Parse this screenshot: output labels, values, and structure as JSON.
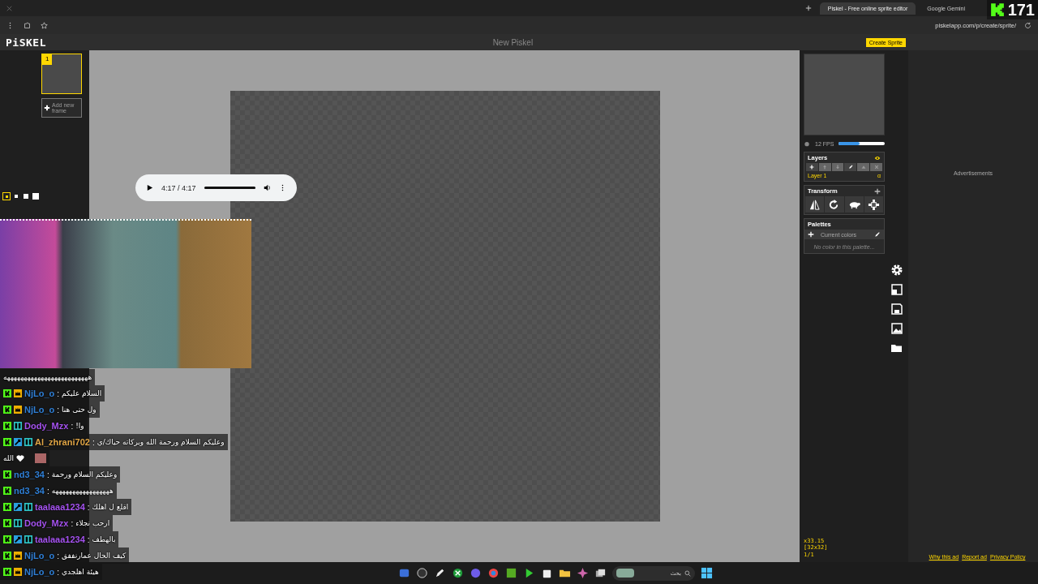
{
  "browser": {
    "tabs": [
      {
        "title": "Piskel - Free online sprite editor",
        "selected": true
      },
      {
        "title": "Google Gemini",
        "selected": false
      }
    ],
    "url": "piskelapp.com/p/create/sprite/"
  },
  "stream_overlay": {
    "viewer_count": "171"
  },
  "piskel": {
    "logo": "PiSKEL",
    "title": "New Piskel",
    "create_button": "Create Sprite",
    "frames": [
      {
        "number": "1",
        "selected": true
      }
    ],
    "add_frame": "Add new frame",
    "pen_sizes": [
      {
        "selected": true
      },
      {
        "selected": false
      },
      {
        "selected": false
      },
      {
        "selected": false
      }
    ],
    "preview": {
      "fps": "12 FPS",
      "level": 0.45
    },
    "layers": {
      "title": "Layers",
      "items": [
        {
          "name": "Layer 1",
          "opacity": "α",
          "selected": true
        }
      ]
    },
    "transform": {
      "title": "Transform"
    },
    "palettes": {
      "title": "Palettes",
      "current": "Current colors",
      "empty_message": "No color in this palette..."
    },
    "status": [
      "x33.15",
      "[32x32]",
      "1/1"
    ]
  },
  "audio_player": {
    "time": "4:17 / 4:17",
    "level": 1
  },
  "ads": {
    "label": "Advertisements",
    "links": [
      "Why this ad",
      "Report ad",
      "Privacy Policy"
    ]
  },
  "chat": {
    "messages": [
      {
        "kind": "plain",
        "text": "هههههههههههههههههههههههههه"
      },
      {
        "kind": "message",
        "user": "NjLo_o",
        "color": "#2f7fd6",
        "badges": [
          {
            "kind": "kick"
          },
          {
            "kind": "crown"
          }
        ],
        "separator": ":",
        "text": "السلام عليكم"
      },
      {
        "kind": "message",
        "user": "NjLo_o",
        "color": "#2f7fd6",
        "badges": [
          {
            "kind": "kick"
          },
          {
            "kind": "crown"
          }
        ],
        "separator": ":",
        "text": "ول حتى هنا"
      },
      {
        "kind": "message",
        "user": "Dody_Mzx",
        "color": "#a552f0",
        "badges": [
          {
            "kind": "kick"
          },
          {
            "kind": "sub"
          }
        ],
        "separator": ":",
        "text": "وا!"
      },
      {
        "kind": "message",
        "user": "Al_zhrani702",
        "color": "#e0a545",
        "badges": [
          {
            "kind": "kick"
          },
          {
            "kind": "gift"
          },
          {
            "kind": "sub"
          }
        ],
        "separator": ":",
        "text": "وعليكم السلام ورحمة الله وبركاته حياك/ي"
      },
      {
        "kind": "emote",
        "text": "الله"
      },
      {
        "kind": "message",
        "user": "nd3_34",
        "color": "#2f7fd6",
        "badges": [
          {
            "kind": "kick"
          }
        ],
        "separator": ":",
        "text": "وعليكم السلام ورحمة"
      },
      {
        "kind": "message",
        "user": "nd3_34",
        "color": "#2f7fd6",
        "badges": [
          {
            "kind": "kick"
          }
        ],
        "separator": ":",
        "text": "هههههههههههههههههه"
      },
      {
        "kind": "message",
        "user": "taalaaa1234",
        "color": "#a552f0",
        "badges": [
          {
            "kind": "kick"
          },
          {
            "kind": "gift"
          },
          {
            "kind": "sub"
          }
        ],
        "separator": ":",
        "text": "اقلع ل اهلك"
      },
      {
        "kind": "message",
        "user": "Dody_Mzx",
        "color": "#a552f0",
        "badges": [
          {
            "kind": "kick"
          },
          {
            "kind": "sub"
          }
        ],
        "separator": ":",
        "text": "ارحب نجلاء"
      },
      {
        "kind": "message",
        "user": "taalaaa1234",
        "color": "#a552f0",
        "badges": [
          {
            "kind": "kick"
          },
          {
            "kind": "gift"
          },
          {
            "kind": "sub"
          }
        ],
        "separator": ":",
        "text": "بالهطف"
      },
      {
        "kind": "message",
        "user": "NjLo_o",
        "color": "#2f7fd6",
        "badges": [
          {
            "kind": "kick"
          },
          {
            "kind": "crown"
          }
        ],
        "separator": ":",
        "text": "كيف الحال عمارنففق"
      },
      {
        "kind": "message",
        "user": "NjLo_o",
        "color": "#2f7fd6",
        "badges": [
          {
            "kind": "kick"
          },
          {
            "kind": "crown"
          }
        ],
        "separator": ":",
        "text": "هيئة اهلجدي"
      }
    ]
  },
  "taskbar": {
    "search_placeholder": "بحث"
  }
}
